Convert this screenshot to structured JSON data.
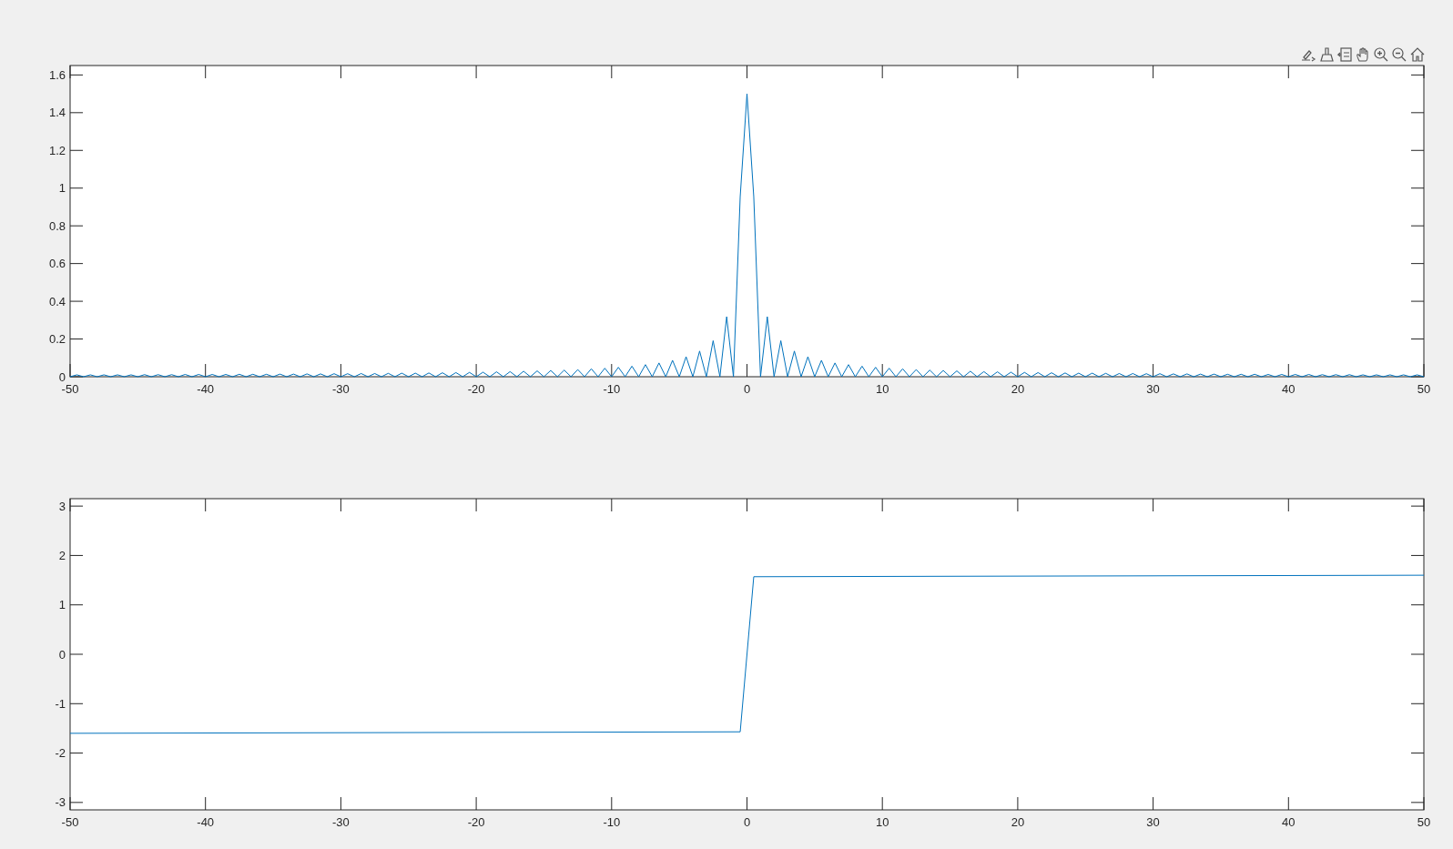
{
  "plots": [
    {
      "chart_data": {
        "type": "line",
        "xlim": [
          -50,
          50
        ],
        "ylim": [
          0,
          1.65
        ],
        "xticks": [
          -50,
          -40,
          -30,
          -20,
          -10,
          0,
          10,
          20,
          30,
          40,
          50
        ],
        "yticks": [
          0,
          0.2,
          0.4,
          0.6,
          0.8,
          1,
          1.2,
          1.4,
          1.6
        ],
        "x": [
          -50,
          -49.5,
          -49,
          -48.5,
          -48,
          -47.5,
          -47,
          -46.5,
          -46,
          -45.5,
          -45,
          -44.5,
          -44,
          -43.5,
          -43,
          -42.5,
          -42,
          -41.5,
          -41,
          -40.5,
          -40,
          -39.5,
          -39,
          -38.5,
          -38,
          -37.5,
          -37,
          -36.5,
          -36,
          -35.5,
          -35,
          -34.5,
          -34,
          -33.5,
          -33,
          -32.5,
          -32,
          -31.5,
          -31,
          -30.5,
          -30,
          -29.5,
          -29,
          -28.5,
          -28,
          -27.5,
          -27,
          -26.5,
          -26,
          -25.5,
          -25,
          -24.5,
          -24,
          -23.5,
          -23,
          -22.5,
          -22,
          -21.5,
          -21,
          -20.5,
          -20,
          -19.5,
          -19,
          -18.5,
          -18,
          -17.5,
          -17,
          -16.5,
          -16,
          -15.5,
          -15,
          -14.5,
          -14,
          -13.5,
          -13,
          -12.5,
          -12,
          -11.5,
          -11,
          -10.5,
          -10,
          -9.5,
          -9,
          -8.5,
          -8,
          -7.5,
          -7,
          -6.5,
          -6,
          -5.5,
          -5,
          -4.5,
          -4,
          -3.5,
          -3,
          -2.5,
          -2,
          -1.5,
          -1,
          -0.5,
          0,
          0.5,
          1,
          1.5,
          2,
          2.5,
          3,
          3.5,
          4,
          4.5,
          5,
          5.5,
          6,
          6.5,
          7,
          7.5,
          8,
          8.5,
          9,
          9.5,
          10,
          10.5,
          11,
          11.5,
          12,
          12.5,
          13,
          13.5,
          14,
          14.5,
          15,
          15.5,
          16,
          16.5,
          17,
          17.5,
          18,
          18.5,
          19,
          19.5,
          20,
          20.5,
          21,
          21.5,
          22,
          22.5,
          23,
          23.5,
          24,
          24.5,
          25,
          25.5,
          26,
          26.5,
          27,
          27.5,
          28,
          28.5,
          29,
          29.5,
          30,
          30.5,
          31,
          31.5,
          32,
          32.5,
          33,
          33.5,
          34,
          34.5,
          35,
          35.5,
          36,
          36.5,
          37,
          37.5,
          38,
          38.5,
          39,
          39.5,
          40,
          40.5,
          41,
          41.5,
          42,
          42.5,
          43,
          43.5,
          44,
          44.5,
          45,
          45.5,
          46,
          46.5,
          47,
          47.5,
          48,
          48.5,
          49,
          49.5,
          50
        ],
        "series": [
          {
            "color": "#0072bd",
            "values": [
              0,
              0.01,
              0,
              0.01,
              0,
              0.01,
              0,
              0.01,
              0,
              0.01,
              0,
              0.011,
              0,
              0.011,
              0,
              0.011,
              0,
              0.012,
              0,
              0.012,
              0,
              0.012,
              0,
              0.012,
              0,
              0.013,
              0,
              0.013,
              0,
              0.013,
              0,
              0.014,
              0,
              0.014,
              0,
              0.015,
              0,
              0.015,
              0,
              0.016,
              0,
              0.016,
              0,
              0.017,
              0,
              0.017,
              0,
              0.018,
              0,
              0.019,
              0,
              0.019,
              0,
              0.02,
              0,
              0.021,
              0,
              0.022,
              0,
              0.023,
              0,
              0.024,
              0,
              0.026,
              0,
              0.027,
              0,
              0.029,
              0,
              0.031,
              0,
              0.033,
              0,
              0.035,
              0,
              0.038,
              0,
              0.042,
              0,
              0.045,
              0,
              0.05,
              0,
              0.056,
              0,
              0.064,
              0,
              0.073,
              0,
              0.087,
              0,
              0.106,
              0,
              0.136,
              0,
              0.191,
              0,
              0.318,
              0,
              0.955,
              1.5,
              0.955,
              0,
              0.318,
              0,
              0.191,
              0,
              0.136,
              0,
              0.106,
              0,
              0.087,
              0,
              0.073,
              0,
              0.064,
              0,
              0.056,
              0,
              0.05,
              0,
              0.045,
              0,
              0.042,
              0,
              0.038,
              0,
              0.035,
              0,
              0.033,
              0,
              0.031,
              0,
              0.029,
              0,
              0.027,
              0,
              0.026,
              0,
              0.024,
              0,
              0.023,
              0,
              0.022,
              0,
              0.021,
              0,
              0.02,
              0,
              0.019,
              0,
              0.019,
              0,
              0.018,
              0,
              0.017,
              0,
              0.017,
              0,
              0.016,
              0,
              0.016,
              0,
              0.015,
              0,
              0.015,
              0,
              0.014,
              0,
              0.014,
              0,
              0.013,
              0,
              0.013,
              0,
              0.013,
              0,
              0.012,
              0,
              0.012,
              0,
              0.012,
              0,
              0.012,
              0,
              0.011,
              0,
              0.011,
              0,
              0.011,
              0,
              0.01,
              0,
              0.01,
              0,
              0.01,
              0,
              0.01,
              0,
              0.01,
              0
            ]
          }
        ]
      }
    },
    {
      "chart_data": {
        "type": "line",
        "xlim": [
          -50,
          50
        ],
        "ylim": [
          -3.15,
          3.15
        ],
        "xticks": [
          -50,
          -40,
          -30,
          -20,
          -10,
          0,
          10,
          20,
          30,
          40,
          50
        ],
        "yticks": [
          -3,
          -2,
          -1,
          0,
          1,
          2,
          3
        ],
        "x": [
          -50,
          -0.5,
          0.5,
          50
        ],
        "series": [
          {
            "color": "#0072bd",
            "values": [
              -1.6,
              -1.57,
              1.57,
              1.6
            ]
          }
        ]
      }
    }
  ]
}
